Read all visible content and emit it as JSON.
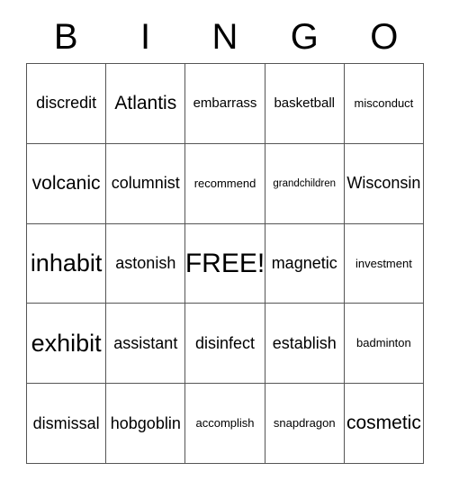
{
  "card": {
    "header": {
      "letters": [
        "B",
        "I",
        "N",
        "G",
        "O"
      ]
    },
    "rows": [
      [
        {
          "text": "discredit",
          "size": "md"
        },
        {
          "text": "Atlantis",
          "size": "lg"
        },
        {
          "text": "embarrass",
          "size": "sm"
        },
        {
          "text": "basketball",
          "size": "sm"
        },
        {
          "text": "misconduct",
          "size": "xs"
        }
      ],
      [
        {
          "text": "volcanic",
          "size": "lg"
        },
        {
          "text": "columnist",
          "size": "md"
        },
        {
          "text": "recommend",
          "size": "xs"
        },
        {
          "text": "grandchildren",
          "size": "xxs"
        },
        {
          "text": "Wisconsin",
          "size": "md"
        }
      ],
      [
        {
          "text": "inhabit",
          "size": "xl"
        },
        {
          "text": "astonish",
          "size": "md"
        },
        {
          "text": "FREE!",
          "size": "free"
        },
        {
          "text": "magnetic",
          "size": "md"
        },
        {
          "text": "investment",
          "size": "xs"
        }
      ],
      [
        {
          "text": "exhibit",
          "size": "xl"
        },
        {
          "text": "assistant",
          "size": "md"
        },
        {
          "text": "disinfect",
          "size": "md"
        },
        {
          "text": "establish",
          "size": "md"
        },
        {
          "text": "badminton",
          "size": "xs"
        }
      ],
      [
        {
          "text": "dismissal",
          "size": "md"
        },
        {
          "text": "hobgoblin",
          "size": "md"
        },
        {
          "text": "accomplish",
          "size": "xs"
        },
        {
          "text": "snapdragon",
          "size": "xs"
        },
        {
          "text": "cosmetic",
          "size": "lg"
        }
      ]
    ],
    "colors": {
      "grid_line": "#555555",
      "text": "#000000",
      "background": "#ffffff"
    }
  }
}
